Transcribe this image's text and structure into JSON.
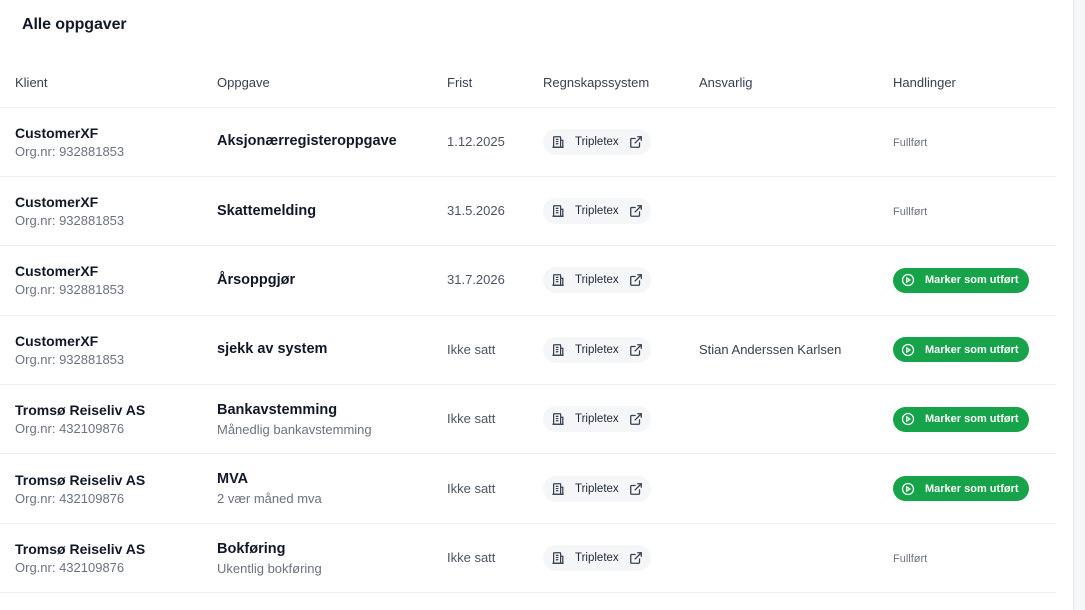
{
  "page": {
    "title": "Alle oppgaver"
  },
  "columns": {
    "client": "Klient",
    "task": "Oppgave",
    "deadline": "Frist",
    "system": "Regnskapssystem",
    "responsible": "Ansvarlig",
    "actions": "Handlinger"
  },
  "rows": [
    {
      "client": "CustomerXF",
      "org": "Org.nr: 932881853",
      "task": "Aksjonærregisteroppgave",
      "task_sub": "",
      "deadline": "1.12.2025",
      "system": "Tripletex",
      "responsible": "",
      "action": "done",
      "action_label": "Fullført"
    },
    {
      "client": "CustomerXF",
      "org": "Org.nr: 932881853",
      "task": "Skattemelding",
      "task_sub": "",
      "deadline": "31.5.2026",
      "system": "Tripletex",
      "responsible": "",
      "action": "done",
      "action_label": "Fullført"
    },
    {
      "client": "CustomerXF",
      "org": "Org.nr: 932881853",
      "task": "Årsoppgjør",
      "task_sub": "",
      "deadline": "31.7.2026",
      "system": "Tripletex",
      "responsible": "",
      "action": "mark",
      "action_label": "Marker som utført"
    },
    {
      "client": "CustomerXF",
      "org": "Org.nr: 932881853",
      "task": "sjekk av system",
      "task_sub": "",
      "deadline": "Ikke satt",
      "system": "Tripletex",
      "responsible": "Stian Anderssen Karlsen",
      "action": "mark",
      "action_label": "Marker som utført"
    },
    {
      "client": "Tromsø Reiseliv AS",
      "org": "Org.nr: 432109876",
      "task": "Bankavstemming",
      "task_sub": "Månedlig bankavstemming",
      "deadline": "Ikke satt",
      "system": "Tripletex",
      "responsible": "",
      "action": "mark",
      "action_label": "Marker som utført"
    },
    {
      "client": "Tromsø Reiseliv AS",
      "org": "Org.nr: 432109876",
      "task": "MVA",
      "task_sub": "2 vær måned mva",
      "deadline": "Ikke satt",
      "system": "Tripletex",
      "responsible": "",
      "action": "mark",
      "action_label": "Marker som utført"
    },
    {
      "client": "Tromsø Reiseliv AS",
      "org": "Org.nr: 432109876",
      "task": "Bokføring",
      "task_sub": "Ukentlig bokføring",
      "deadline": "Ikke satt",
      "system": "Tripletex",
      "responsible": "",
      "action": "done",
      "action_label": "Fullført"
    }
  ],
  "icons": {
    "system": "building-icon",
    "external": "external-link-icon",
    "play": "play-circle-icon"
  },
  "colors": {
    "accent_green": "#16a34a",
    "pill_bg": "#f5f6f8"
  }
}
